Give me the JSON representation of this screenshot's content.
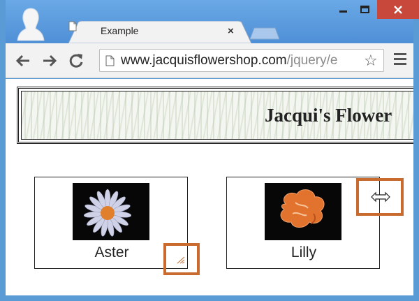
{
  "tab": {
    "title": "Example",
    "close_label": "×"
  },
  "toolbar": {
    "url_host": "www.jacquisflowershop.com",
    "url_path": "/jquery/e"
  },
  "page": {
    "banner_title": "Jacqui's Flower",
    "products": [
      {
        "name": "Aster"
      },
      {
        "name": "Lilly"
      }
    ]
  },
  "icons": [
    "profile-icon",
    "document-icon",
    "back-arrow-icon",
    "forward-arrow-icon",
    "reload-icon",
    "star-icon",
    "menu-icon",
    "resize-grip-icon",
    "ew-resize-cursor-icon"
  ],
  "colors": {
    "highlight": "#c96a2e",
    "frame": "#4a90d9",
    "close_button": "#c9483c"
  }
}
